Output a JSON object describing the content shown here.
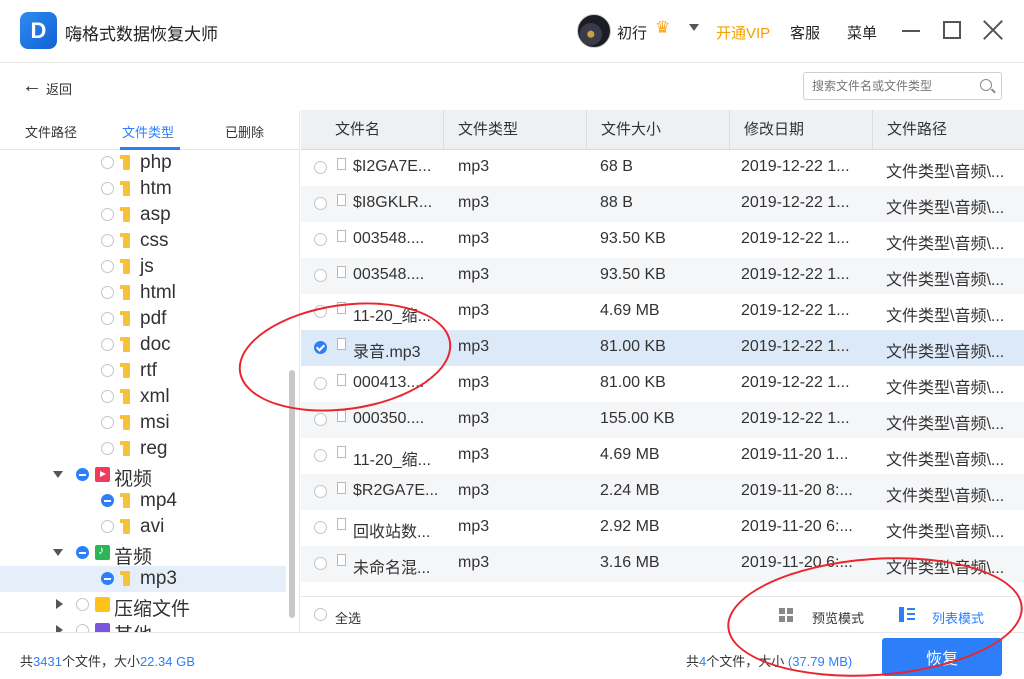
{
  "app": {
    "logo_letter": "D",
    "title": "嗨格式数据恢复大师",
    "username": "初行",
    "vip_label": "开通VIP",
    "service_label": "客服",
    "menu_label": "菜单"
  },
  "toolbar": {
    "back_label": "返回",
    "search_placeholder": "搜索文件名或文件类型"
  },
  "left_tabs": [
    "文件路径",
    "文件类型",
    "已删除"
  ],
  "tree": {
    "php": "php",
    "htm": "htm",
    "asp": "asp",
    "css": "css",
    "js": "js",
    "html": "html",
    "pdf": "pdf",
    "doc": "doc",
    "rtf": "rtf",
    "xml": "xml",
    "msi": "msi",
    "reg": "reg",
    "video": "视频",
    "mp4": "mp4",
    "avi": "avi",
    "audio": "音频",
    "mp3": "mp3",
    "zip": "压缩文件",
    "other": "其他"
  },
  "table": {
    "headers": [
      "文件名",
      "文件类型",
      "文件大小",
      "修改日期",
      "文件路径"
    ],
    "rows": [
      [
        "$I2GA7E...",
        "mp3",
        "68 B",
        "2019-12-22 1...",
        "文件类型\\音频\\..."
      ],
      [
        "$I8GKLR...",
        "mp3",
        "88 B",
        "2019-12-22 1...",
        "文件类型\\音频\\..."
      ],
      [
        "003548....",
        "mp3",
        "93.50 KB",
        "2019-12-22 1...",
        "文件类型\\音频\\..."
      ],
      [
        "003548....",
        "mp3",
        "93.50 KB",
        "2019-12-22 1...",
        "文件类型\\音频\\..."
      ],
      [
        "11-20_缩...",
        "mp3",
        "4.69 MB",
        "2019-12-22 1...",
        "文件类型\\音频\\..."
      ],
      [
        "录音.mp3",
        "mp3",
        "81.00 KB",
        "2019-12-22 1...",
        "文件类型\\音频\\..."
      ],
      [
        "000413....",
        "mp3",
        "81.00 KB",
        "2019-12-22 1...",
        "文件类型\\音频\\..."
      ],
      [
        "000350....",
        "mp3",
        "155.00 KB",
        "2019-12-22 1...",
        "文件类型\\音频\\..."
      ],
      [
        "11-20_缩...",
        "mp3",
        "4.69 MB",
        "2019-11-20 1...",
        "文件类型\\音频\\..."
      ],
      [
        "$R2GA7E...",
        "mp3",
        "2.24 MB",
        "2019-11-20 8:...",
        "文件类型\\音频\\..."
      ],
      [
        "回收站数...",
        "mp3",
        "2.92 MB",
        "2019-11-20 6:...",
        "文件类型\\音频\\..."
      ],
      [
        "未命名混...",
        "mp3",
        "3.16 MB",
        "2019-11-20 6:...",
        "文件类型\\音频\\..."
      ]
    ],
    "selected_row": 5
  },
  "footer": {
    "select_all": "全选",
    "preview_mode": "预览模式",
    "list_mode": "列表模式"
  },
  "status": {
    "total_prefix": "共",
    "total_count": "3431",
    "total_mid": "个文件，大小",
    "total_size": "22.34 GB",
    "sel_prefix": "共",
    "sel_count": "4",
    "sel_mid": "个文件，大小",
    "sel_size": "(37.79 MB)",
    "recover_label": "恢复"
  },
  "colors": {
    "accent": "#2d7ff9",
    "vip": "#f5a000",
    "annotation": "#e8262c"
  }
}
